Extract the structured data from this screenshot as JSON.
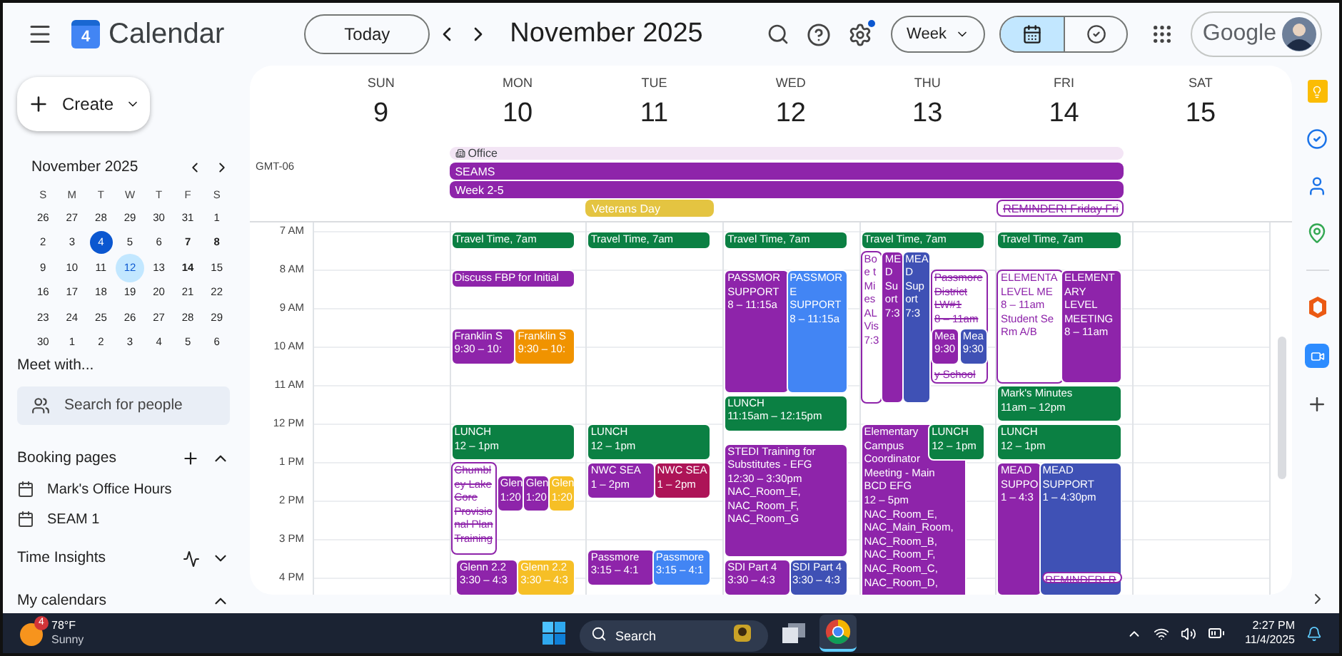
{
  "topbar": {
    "app_name": "Calendar",
    "logo_day": "4",
    "today_button": "Today",
    "month_title": "November 2025",
    "settings_update": true,
    "view_select": "Week",
    "view_toggle": [
      {
        "kind": "calendar",
        "selected": true
      },
      {
        "kind": "tasks",
        "selected": false
      }
    ],
    "account_label": "Google"
  },
  "sidebar": {
    "create_button": "Create",
    "mini_calendar": {
      "title": "November 2025",
      "weekdays": [
        "S",
        "M",
        "T",
        "W",
        "T",
        "F",
        "S"
      ],
      "days": [
        {
          "label": "26",
          "today": false,
          "selected": false,
          "bold": false
        },
        {
          "label": "27",
          "today": false,
          "selected": false,
          "bold": false
        },
        {
          "label": "28",
          "today": false,
          "selected": false,
          "bold": false
        },
        {
          "label": "29",
          "today": false,
          "selected": false,
          "bold": false
        },
        {
          "label": "30",
          "today": false,
          "selected": false,
          "bold": false
        },
        {
          "label": "31",
          "today": false,
          "selected": false,
          "bold": false
        },
        {
          "label": "1",
          "today": false,
          "selected": false,
          "bold": false
        },
        {
          "label": "2",
          "today": false,
          "selected": false,
          "bold": false
        },
        {
          "label": "3",
          "today": false,
          "selected": false,
          "bold": false
        },
        {
          "label": "4",
          "today": true,
          "selected": false,
          "bold": false
        },
        {
          "label": "5",
          "today": false,
          "selected": false,
          "bold": false
        },
        {
          "label": "6",
          "today": false,
          "selected": false,
          "bold": false
        },
        {
          "label": "7",
          "today": false,
          "selected": false,
          "bold": true
        },
        {
          "label": "8",
          "today": false,
          "selected": false,
          "bold": true
        },
        {
          "label": "9",
          "today": false,
          "selected": false,
          "bold": false
        },
        {
          "label": "10",
          "today": false,
          "selected": false,
          "bold": false
        },
        {
          "label": "11",
          "today": false,
          "selected": false,
          "bold": false
        },
        {
          "label": "12",
          "today": false,
          "selected": true,
          "bold": false
        },
        {
          "label": "13",
          "today": false,
          "selected": false,
          "bold": false
        },
        {
          "label": "14",
          "today": false,
          "selected": false,
          "bold": true
        },
        {
          "label": "15",
          "today": false,
          "selected": false,
          "bold": false
        },
        {
          "label": "16",
          "today": false,
          "selected": false,
          "bold": false
        },
        {
          "label": "17",
          "today": false,
          "selected": false,
          "bold": false
        },
        {
          "label": "18",
          "today": false,
          "selected": false,
          "bold": false
        },
        {
          "label": "19",
          "today": false,
          "selected": false,
          "bold": false
        },
        {
          "label": "20",
          "today": false,
          "selected": false,
          "bold": false
        },
        {
          "label": "21",
          "today": false,
          "selected": false,
          "bold": false
        },
        {
          "label": "22",
          "today": false,
          "selected": false,
          "bold": false
        },
        {
          "label": "23",
          "today": false,
          "selected": false,
          "bold": false
        },
        {
          "label": "24",
          "today": false,
          "selected": false,
          "bold": false
        },
        {
          "label": "25",
          "today": false,
          "selected": false,
          "bold": false
        },
        {
          "label": "26",
          "today": false,
          "selected": false,
          "bold": false
        },
        {
          "label": "27",
          "today": false,
          "selected": false,
          "bold": false
        },
        {
          "label": "28",
          "today": false,
          "selected": false,
          "bold": false
        },
        {
          "label": "29",
          "today": false,
          "selected": false,
          "bold": false
        },
        {
          "label": "30",
          "today": false,
          "selected": false,
          "bold": false
        },
        {
          "label": "1",
          "today": false,
          "selected": false,
          "bold": false
        },
        {
          "label": "2",
          "today": false,
          "selected": false,
          "bold": false
        },
        {
          "label": "3",
          "today": false,
          "selected": false,
          "bold": false
        },
        {
          "label": "4",
          "today": false,
          "selected": false,
          "bold": false
        },
        {
          "label": "5",
          "today": false,
          "selected": false,
          "bold": false
        },
        {
          "label": "6",
          "today": false,
          "selected": false,
          "bold": false
        }
      ]
    },
    "meet_with": "Meet with...",
    "people_search": {
      "placeholder": "Search for people"
    },
    "sections": [
      {
        "kind": "booking",
        "title": "Booking pages",
        "expanded": true,
        "items": [
          "Mark's Office Hours",
          "SEAM 1"
        ]
      },
      {
        "kind": "insights",
        "title": "Time Insights",
        "expanded": false
      },
      {
        "kind": "calendars",
        "title": "My calendars",
        "expanded": true
      }
    ]
  },
  "week": {
    "timezone": "GMT-06",
    "hours": [
      "7 AM",
      "8 AM",
      "9 AM",
      "10 AM",
      "11 AM",
      "12 PM",
      "1 PM",
      "2 PM",
      "3 PM",
      "4 PM"
    ],
    "days": [
      {
        "weekday": "SUN",
        "date": "9"
      },
      {
        "weekday": "MON",
        "date": "10",
        "events": [
          {
            "kind": "solid",
            "color": "#0b8043",
            "title": "Travel Time, 7am"
          },
          {
            "kind": "solid",
            "color": "#8e24aa",
            "title": "Discuss FBP for Initial"
          },
          {
            "kind": "solid",
            "color": "#8e24aa",
            "title": "Franklin S",
            "lines": [
              "9:30 – 10:"
            ]
          },
          {
            "kind": "solid",
            "color": "#f09300",
            "title": "Franklin S",
            "lines": [
              "9:30 – 10:"
            ]
          },
          {
            "kind": "solid",
            "color": "#0b8043",
            "title": "LUNCH",
            "lines": [
              "12 – 1pm"
            ]
          },
          {
            "kind": "declined",
            "color": "#8e24aa",
            "title": "Chumbl\ney Lake\nCore\nProvisio\nnal Plan\nTraining"
          },
          {
            "kind": "solid",
            "color": "#8e24aa",
            "title": "Glen",
            "lines": [
              "1:20"
            ]
          },
          {
            "kind": "solid",
            "color": "#8e24aa",
            "title": "Glen",
            "lines": [
              "1:20"
            ]
          },
          {
            "kind": "solid",
            "color": "#f6bf26",
            "title": "Glen",
            "lines": [
              "1:20"
            ]
          },
          {
            "kind": "solid",
            "color": "#8e24aa",
            "title": "Glenn 2.2",
            "lines": [
              "3:30 – 4:3"
            ]
          },
          {
            "kind": "solid",
            "color": "#f6bf26",
            "title": "Glenn 2.2",
            "lines": [
              "3:30 – 4:3"
            ]
          }
        ]
      },
      {
        "weekday": "TUE",
        "date": "11",
        "events": [
          {
            "kind": "solid",
            "color": "#0b8043",
            "title": "Travel Time, 7am"
          },
          {
            "kind": "solid",
            "color": "#0b8043",
            "title": "LUNCH",
            "lines": [
              "12 – 1pm"
            ]
          },
          {
            "kind": "solid",
            "color": "#8e24aa",
            "title": "NWC SEA",
            "lines": [
              "1 – 2pm"
            ]
          },
          {
            "kind": "solid",
            "color": "#ad1457",
            "title": "NWC SEA",
            "lines": [
              "1 – 2pm"
            ]
          },
          {
            "kind": "solid",
            "color": "#8e24aa",
            "title": "Passmore",
            "lines": [
              "3:15 – 4:1"
            ]
          },
          {
            "kind": "solid",
            "color": "#4285f4",
            "title": "Passmore",
            "lines": [
              "3:15 – 4:1"
            ]
          }
        ]
      },
      {
        "weekday": "WED",
        "date": "12",
        "events": [
          {
            "kind": "solid",
            "color": "#0b8043",
            "title": "Travel Time, 7am"
          },
          {
            "kind": "solid",
            "color": "#8e24aa",
            "title": "PASSMOR\nSUPPORT",
            "lines": [
              "8 – 11:15a"
            ]
          },
          {
            "kind": "solid",
            "color": "#4285f4",
            "title": "PASSMOR\nE\nSUPPORT",
            "lines": [
              "8 – 11:15a"
            ]
          },
          {
            "kind": "solid",
            "color": "#0b8043",
            "title": "LUNCH",
            "lines": [
              "11:15am – 12:15pm"
            ]
          },
          {
            "kind": "solid",
            "color": "#8e24aa",
            "title": "STEDI Training for\nSubstitutes - EFG",
            "lines": [
              "12:30 – 3:30pm",
              "NAC_Room_E,",
              "NAC_Room_F,",
              "NAC_Room_G"
            ]
          },
          {
            "kind": "solid",
            "color": "#8e24aa",
            "title": "SDI Part 4",
            "lines": [
              "3:30 – 4:3"
            ]
          },
          {
            "kind": "solid",
            "color": "#3f51b5",
            "title": "SDI Part 4",
            "lines": [
              "3:30 – 4:3"
            ]
          }
        ]
      },
      {
        "weekday": "THU",
        "date": "13",
        "events": [
          {
            "kind": "solid",
            "color": "#0b8043",
            "title": "Travel Time, 7am"
          },
          {
            "kind": "outlined",
            "color": "#8e24aa",
            "title": "Bo\ne t\nMi\nes\nAL\nVis",
            "lines": [
              "7:3"
            ]
          },
          {
            "kind": "solid",
            "color": "#8e24aa",
            "title": "ME\nD\nSu\nort",
            "lines": [
              "7:3"
            ]
          },
          {
            "kind": "solid",
            "color": "#3f51b5",
            "title": "MEA\nD\nSup\nort",
            "lines": [
              "7:3"
            ]
          },
          {
            "kind": "declined",
            "color": "#8e24aa",
            "title": "Passmore\nDistrict\nLW#1",
            "lines": [
              "8 – 11am"
            ],
            "footer": "y School"
          },
          {
            "kind": "solid",
            "color": "#8e24aa",
            "title": "Mea",
            "lines": [
              "9:30"
            ]
          },
          {
            "kind": "solid",
            "color": "#3f51b5",
            "title": "Mea",
            "lines": [
              "9:30"
            ]
          },
          {
            "kind": "solid",
            "color": "#8e24aa",
            "title": "Elementary\nCampus\nCoordinator",
            "lines": [
              "Meeting - Main",
              "BCD EFG",
              "12 – 5pm",
              "NAC_Room_E,",
              "NAC_Main_Room,",
              "NAC_Room_B,",
              "NAC_Room_F,",
              "NAC_Room_C,",
              "NAC_Room_D,"
            ]
          },
          {
            "kind": "solid",
            "color": "#0b8043",
            "title": "LUNCH",
            "lines": [
              "12 – 1pm"
            ]
          }
        ]
      },
      {
        "weekday": "FRI",
        "date": "14",
        "events": [
          {
            "kind": "solid",
            "color": "#0b8043",
            "title": "Travel Time, 7am"
          },
          {
            "kind": "outlined",
            "color": "#8e24aa",
            "title": "ELEMENTA\nLEVEL ME",
            "lines": [
              "8 – 11am",
              "Student Se",
              "Rm A/B"
            ]
          },
          {
            "kind": "solid",
            "color": "#8e24aa",
            "title": "ELEMENT\nARY\nLEVEL\nMEETING",
            "lines": [
              "8 – 11am"
            ]
          },
          {
            "kind": "solid",
            "color": "#0b8043",
            "title": "Mark's Minutes",
            "lines": [
              "11am – 12pm"
            ]
          },
          {
            "kind": "solid",
            "color": "#0b8043",
            "title": "LUNCH",
            "lines": [
              "12 – 1pm"
            ]
          },
          {
            "kind": "solid",
            "color": "#8e24aa",
            "title": "MEAD\nSUPPO",
            "lines": [
              "1 – 4:3"
            ]
          },
          {
            "kind": "solid",
            "color": "#3f51b5",
            "title": "MEAD\nSUPPORT",
            "lines": [
              "1 – 4:30pm"
            ]
          },
          {
            "kind": "declined",
            "color": "#8e24aa",
            "title": "REMINDER! R"
          }
        ]
      },
      {
        "weekday": "SAT",
        "date": "15"
      }
    ],
    "all_day_rows": [
      [
        {
          "kind": "location",
          "title": "Office",
          "color": "#f3e5f5"
        }
      ],
      [
        {
          "kind": "solid",
          "title": "SEAMS",
          "color": "#8e24aa"
        }
      ],
      [
        {
          "kind": "solid",
          "title": "Week 2-5",
          "color": "#8e24aa"
        }
      ],
      [
        {
          "kind": "solid",
          "title": "Veterans Day",
          "color": "#e4c441"
        },
        {
          "kind": "declined",
          "title": "REMINDER! Friday Fri",
          "color": "#8e24aa"
        }
      ]
    ]
  },
  "taskbar": {
    "weather": {
      "badge": "4",
      "temp": "78°F",
      "condition": "Sunny"
    },
    "search": {
      "placeholder": "Search"
    },
    "clock": {
      "time": "2:27 PM",
      "date": "11/4/2025"
    }
  }
}
